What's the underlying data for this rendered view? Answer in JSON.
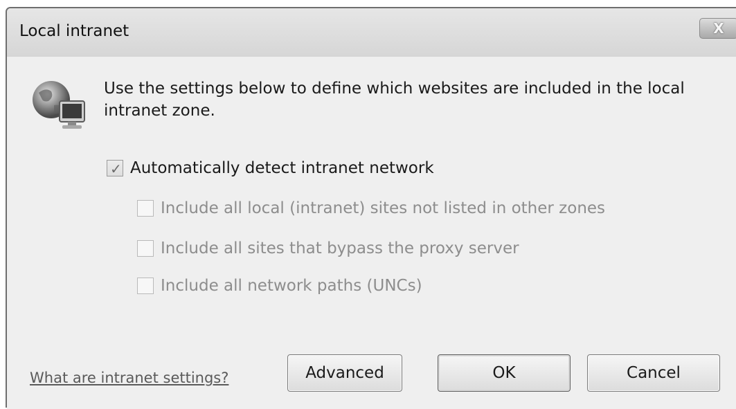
{
  "window": {
    "title": "Local intranet",
    "close_glyph": "X"
  },
  "intro": {
    "icon": "globe-computer-icon",
    "text": "Use the settings below to define which websites are included in the local intranet zone."
  },
  "options": [
    {
      "label": "Automatically detect intranet network",
      "checked": true,
      "enabled": true
    },
    {
      "label": "Include all local (intranet) sites not listed in other zones",
      "checked": false,
      "enabled": false
    },
    {
      "label": "Include all sites that bypass the proxy server",
      "checked": false,
      "enabled": false
    },
    {
      "label": "Include all network paths (UNCs)",
      "checked": false,
      "enabled": false
    }
  ],
  "footer": {
    "help_link": "What are intranet settings?",
    "advanced_label": "Advanced",
    "ok_label": "OK",
    "cancel_label": "Cancel"
  }
}
